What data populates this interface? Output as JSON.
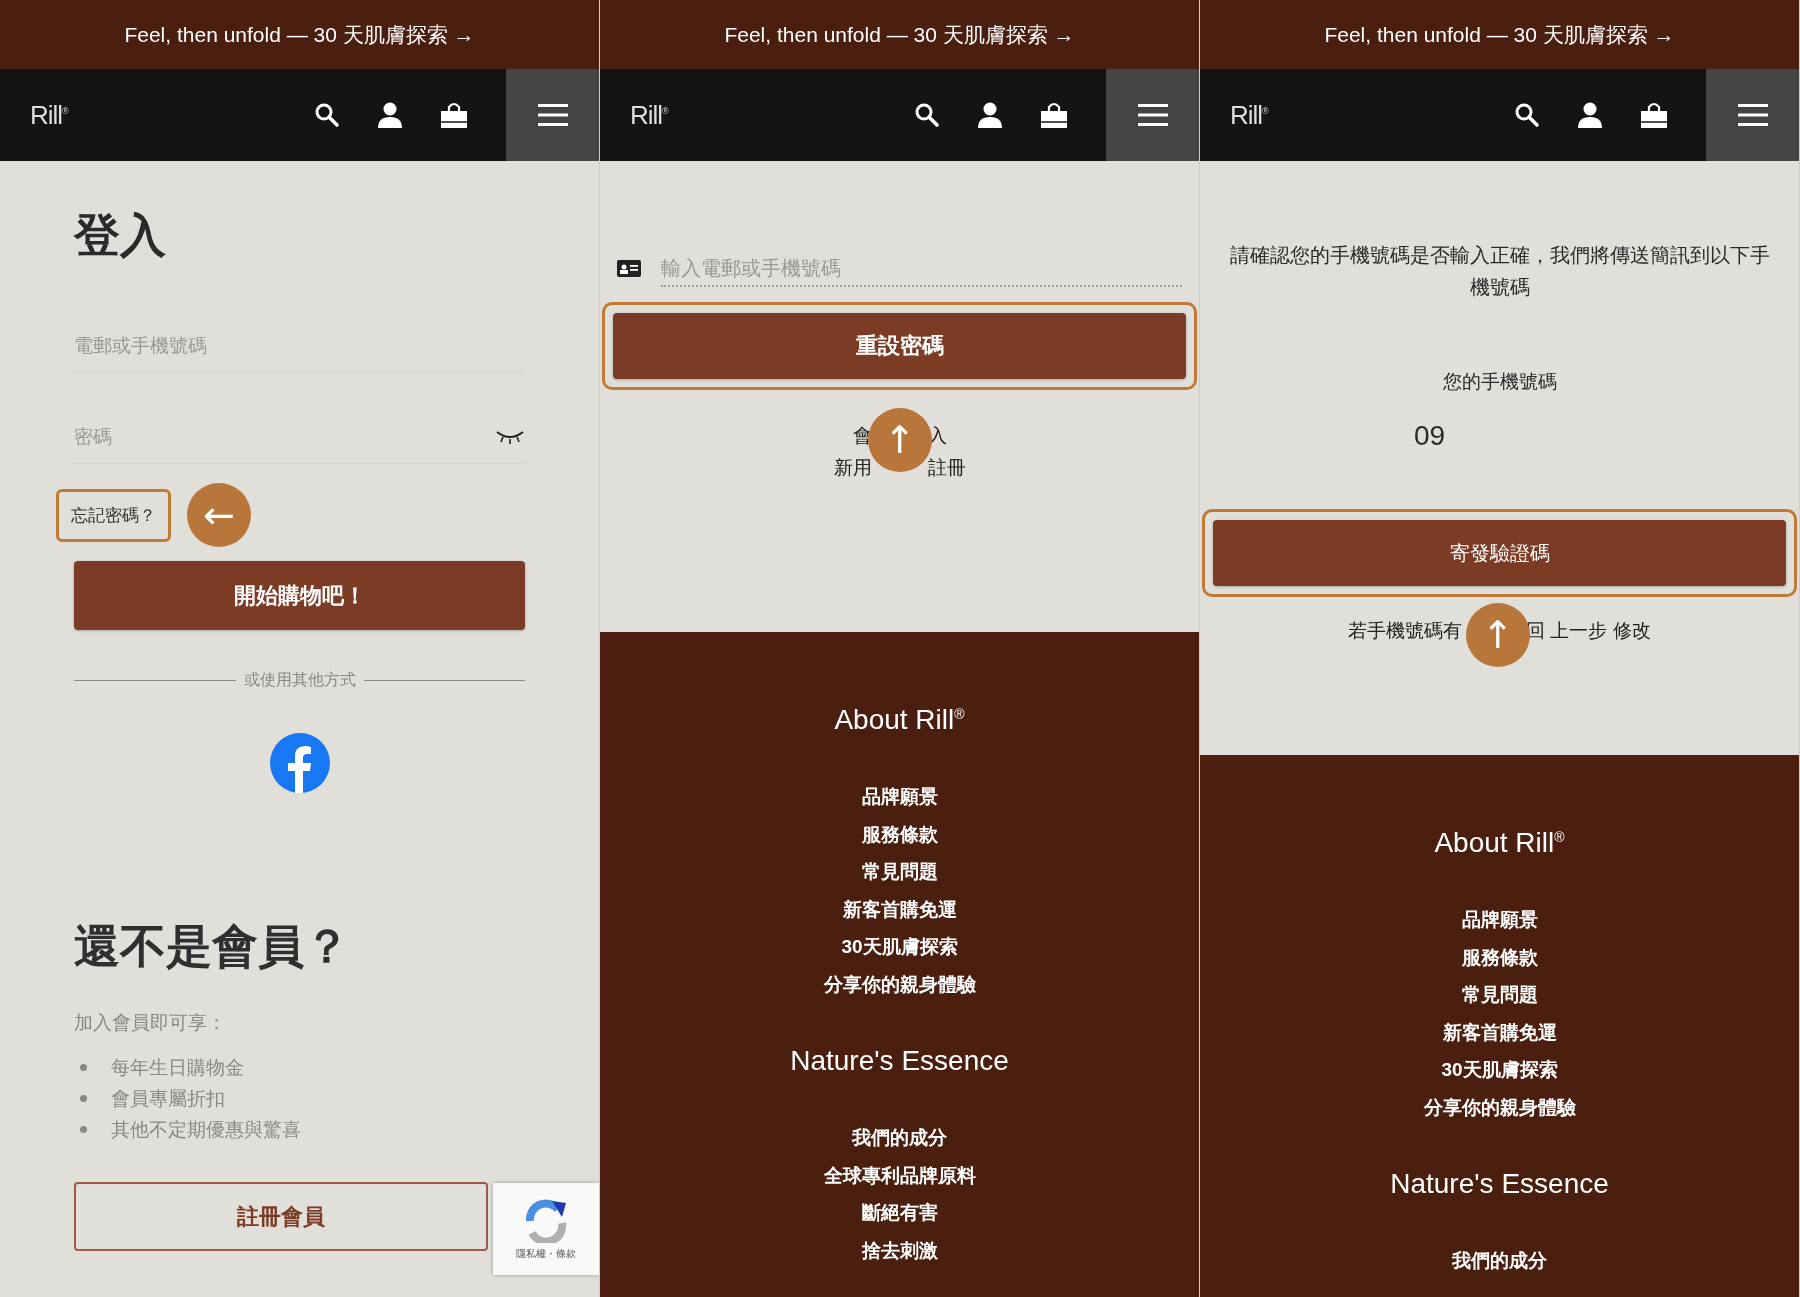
{
  "panels": [
    {
      "kind": "login",
      "banner": "Feel, then unfold — 30 天肌膚探索 →",
      "logo": "Rill$^{®}$",
      "title": "登入",
      "fields": [
        {
          "placeholder": "電郵或手機號碼",
          "kind": "text"
        },
        {
          "placeholder": "密碼",
          "kind": "password"
        }
      ],
      "forgot_link": {
        "label": "忘記密碼？",
        "highlighted": true
      },
      "pointer_arrow": "←",
      "submit_button": {
        "label": "開始購物吧！"
      },
      "divider_text": "或使用其他方式",
      "signup": {
        "heading": "還不是會員？",
        "intro": "加入會員即可享：",
        "benefits": [
          "每年生日購物金",
          "會員專屬折扣",
          "其他不定期優惠與驚喜"
        ],
        "button": "註冊會員"
      },
      "recaptcha": {
        "text": "隱私權・條款"
      }
    },
    {
      "kind": "reset",
      "banner": "Feel, then unfold — 30 天肌膚探索 →",
      "logo": "Rill$^{®}$",
      "field": {
        "placeholder": "輸入電郵或手機號碼"
      },
      "submit_button": {
        "label": "重設密碼",
        "highlighted": true
      },
      "pointer_arrow": "↑",
      "link_lines": [
        [
          "會",
          "入"
        ],
        [
          "新用",
          "註冊"
        ]
      ],
      "footer": [
        {
          "heading": "About Rill$^{®}$",
          "links": [
            "品牌願景",
            "服務條款",
            "常見問題",
            "新客首購免運",
            "30天肌膚探索",
            "分享你的親身體驗"
          ]
        },
        {
          "heading": "Nature's Essence",
          "links": [
            "我們的成分",
            "全球專利品牌原料",
            "斷絕有害",
            "捨去刺激"
          ]
        }
      ]
    },
    {
      "kind": "verify",
      "banner": "Feel, then unfold — 30 天肌膚探索 →",
      "logo": "Rill$^{®}$",
      "message": "請確認您的手機號碼是否輸入正確，我們將傳送簡訊到以下手機號碼",
      "phone_label": "您的手機號碼",
      "phone_value": "09",
      "submit_button": {
        "label": "寄發驗證碼",
        "highlighted": true
      },
      "pointer_arrow": "↑",
      "link_lines": [
        [
          "若手機號碼有",
          "回 上一步 修改"
        ]
      ],
      "footer": [
        {
          "heading": "About Rill$^{®}$",
          "links": [
            "品牌願景",
            "服務條款",
            "常見問題",
            "新客首購免運",
            "30天肌膚探索",
            "分享你的親身體驗"
          ]
        },
        {
          "heading": "Nature's Essence",
          "links": [
            "我們的成分"
          ]
        }
      ]
    }
  ]
}
